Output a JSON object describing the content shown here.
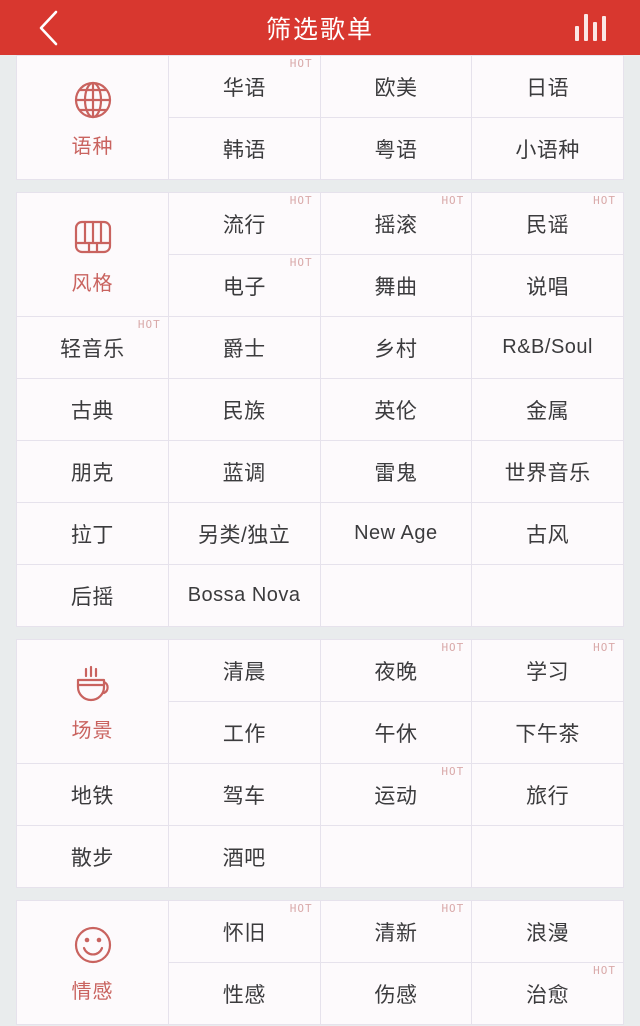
{
  "header": {
    "title": "筛选歌单",
    "back_icon": "chevron-left-icon",
    "equalizer_icon": "equalizer-bars-icon",
    "bg_color": "#d8372f",
    "text_color": "#ffffff"
  },
  "theme": {
    "page_bg": "#e9eced",
    "card_bg": "#fdfafc",
    "border": "#e6e2ec",
    "accent": "#c9635f",
    "hot_color": "#d9a9a9",
    "label_color": "#3b3b3d"
  },
  "hot_badge_text": "HOT",
  "sections": [
    {
      "key": "language",
      "label": "语种",
      "icon": "globe-icon",
      "top_items": [
        {
          "label": "华语",
          "hot": true
        },
        {
          "label": "欧美",
          "hot": false
        },
        {
          "label": "日语",
          "hot": false
        },
        {
          "label": "韩语",
          "hot": false
        },
        {
          "label": "粤语",
          "hot": false
        },
        {
          "label": "小语种",
          "hot": false
        }
      ],
      "wide_items": []
    },
    {
      "key": "style",
      "label": "风格",
      "icon": "piano-icon",
      "top_items": [
        {
          "label": "流行",
          "hot": true
        },
        {
          "label": "摇滚",
          "hot": true
        },
        {
          "label": "民谣",
          "hot": true
        },
        {
          "label": "电子",
          "hot": true
        },
        {
          "label": "舞曲",
          "hot": false
        },
        {
          "label": "说唱",
          "hot": false
        }
      ],
      "wide_items": [
        {
          "label": "轻音乐",
          "hot": true
        },
        {
          "label": "爵士",
          "hot": false
        },
        {
          "label": "乡村",
          "hot": false
        },
        {
          "label": "R&B/Soul",
          "hot": false,
          "latin": true
        },
        {
          "label": "古典",
          "hot": false
        },
        {
          "label": "民族",
          "hot": false
        },
        {
          "label": "英伦",
          "hot": false
        },
        {
          "label": "金属",
          "hot": false
        },
        {
          "label": "朋克",
          "hot": false
        },
        {
          "label": "蓝调",
          "hot": false
        },
        {
          "label": "雷鬼",
          "hot": false
        },
        {
          "label": "世界音乐",
          "hot": false
        },
        {
          "label": "拉丁",
          "hot": false
        },
        {
          "label": "另类/独立",
          "hot": false
        },
        {
          "label": "New Age",
          "hot": false,
          "latin": true
        },
        {
          "label": "古风",
          "hot": false
        },
        {
          "label": "后摇",
          "hot": false
        },
        {
          "label": "Bossa Nova",
          "hot": false,
          "latin": true
        },
        {
          "label": "",
          "hot": false,
          "empty": true
        },
        {
          "label": "",
          "hot": false,
          "empty": true
        }
      ]
    },
    {
      "key": "scene",
      "label": "场景",
      "icon": "coffee-cup-icon",
      "top_items": [
        {
          "label": "清晨",
          "hot": false
        },
        {
          "label": "夜晚",
          "hot": true
        },
        {
          "label": "学习",
          "hot": true
        },
        {
          "label": "工作",
          "hot": false
        },
        {
          "label": "午休",
          "hot": false
        },
        {
          "label": "下午茶",
          "hot": false
        }
      ],
      "wide_items": [
        {
          "label": "地铁",
          "hot": false
        },
        {
          "label": "驾车",
          "hot": false
        },
        {
          "label": "运动",
          "hot": true
        },
        {
          "label": "旅行",
          "hot": false
        },
        {
          "label": "散步",
          "hot": false
        },
        {
          "label": "酒吧",
          "hot": false
        },
        {
          "label": "",
          "hot": false,
          "empty": true
        },
        {
          "label": "",
          "hot": false,
          "empty": true
        }
      ]
    },
    {
      "key": "emotion",
      "label": "情感",
      "icon": "smiley-face-icon",
      "top_items": [
        {
          "label": "怀旧",
          "hot": true
        },
        {
          "label": "清新",
          "hot": true
        },
        {
          "label": "浪漫",
          "hot": false
        },
        {
          "label": "性感",
          "hot": false
        },
        {
          "label": "伤感",
          "hot": false
        },
        {
          "label": "治愈",
          "hot": true
        }
      ],
      "wide_items": []
    }
  ]
}
